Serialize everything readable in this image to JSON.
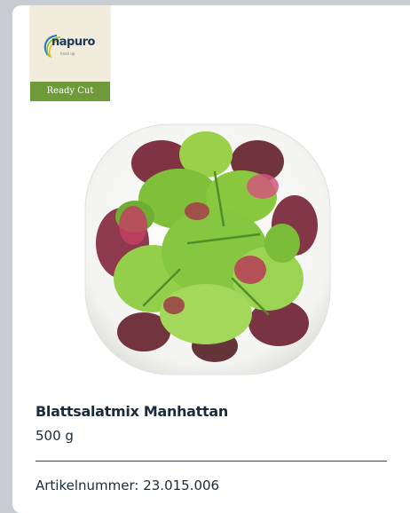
{
  "brand": {
    "logo_text": "napuro",
    "logo_sub": "fresh up",
    "tag": "Ready Cut",
    "icon": "brand-logo-icon"
  },
  "product": {
    "name": "Blattsalatmix Manhattan",
    "weight": "500 g",
    "article_number": "Artikelnummer: 23.015.006",
    "image_icon": "salad-plate-image"
  },
  "colors": {
    "background": "#c9ccd2",
    "card": "#ffffff",
    "text": "#1b2b3a",
    "ready_cut_green": "#6e9a3a",
    "badge_bg": "#f2ecdd"
  }
}
